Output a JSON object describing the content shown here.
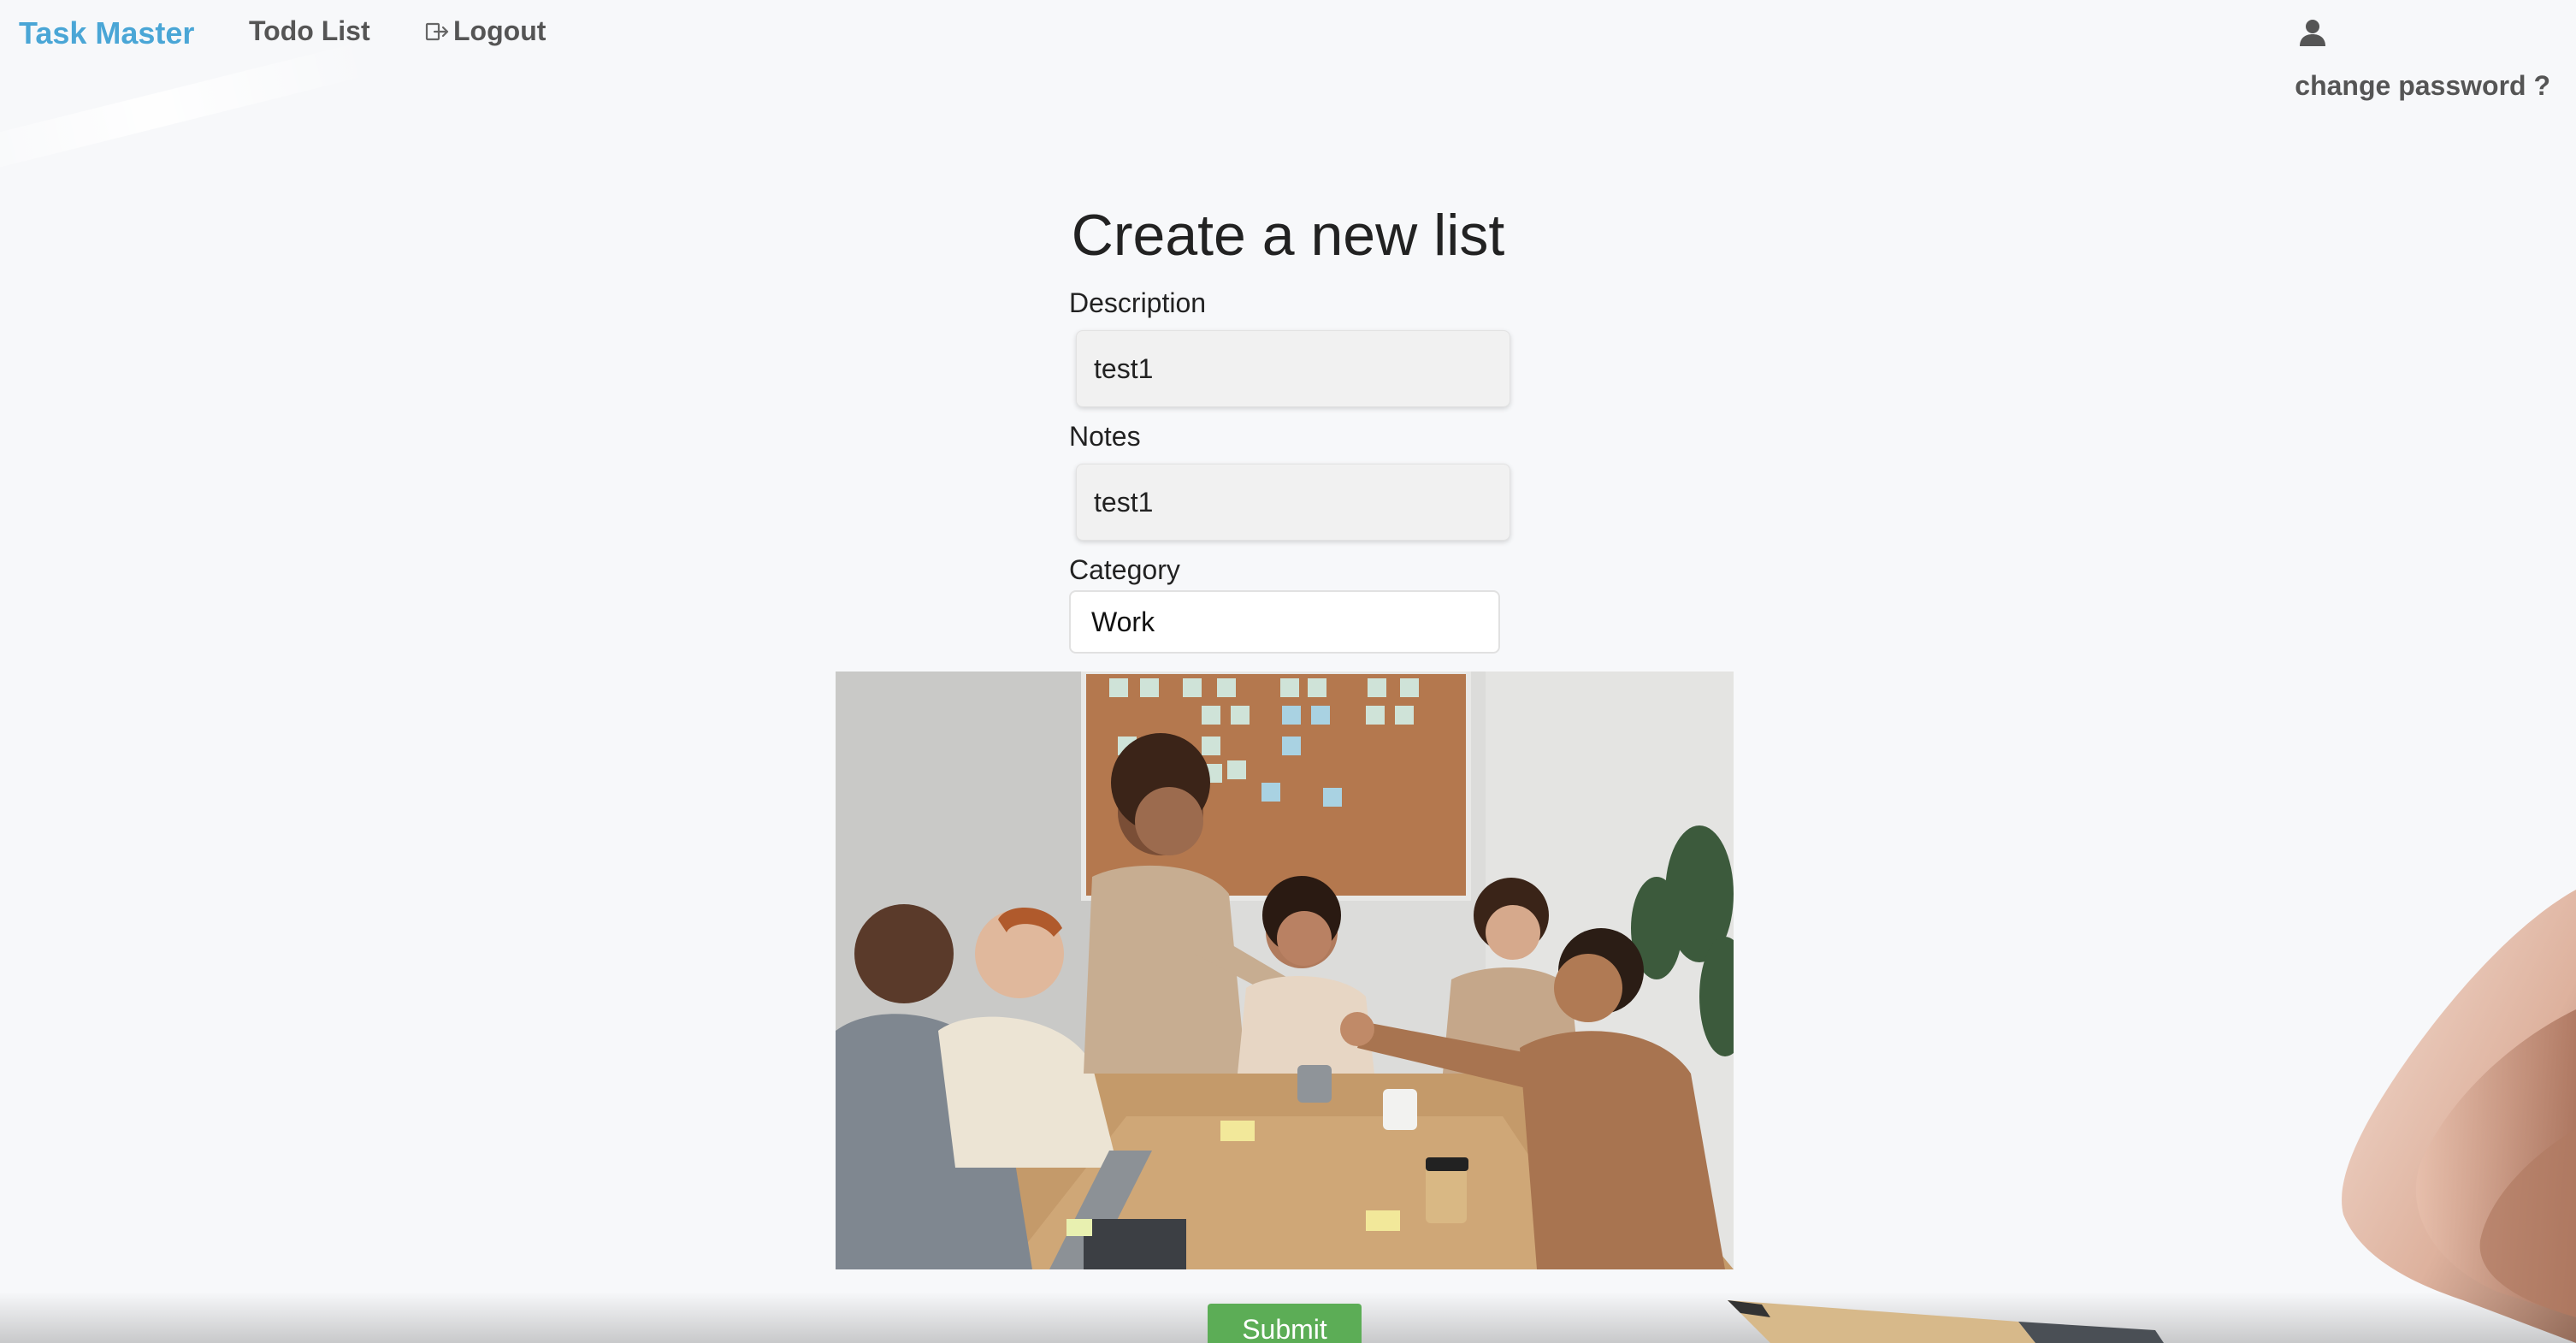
{
  "nav": {
    "brand": "Task Master",
    "todo_list": "Todo List",
    "logout": "Logout",
    "user_icon": "user-icon",
    "change_password": "change password ?"
  },
  "form": {
    "title": "Create a new list",
    "description_label": "Description",
    "description_value": "test1",
    "notes_label": "Notes",
    "notes_value": "test1",
    "category_label": "Category",
    "category_value": "Work",
    "submit_label": "Submit"
  },
  "colors": {
    "brand": "#4aa6d6",
    "submit": "#5cad56",
    "background": "#f7f8fa"
  }
}
